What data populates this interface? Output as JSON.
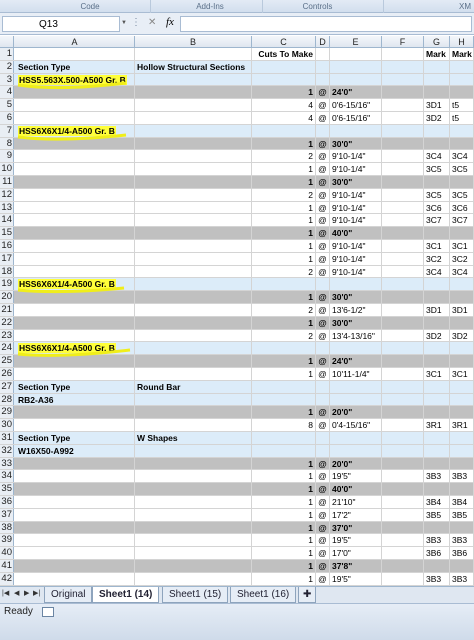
{
  "ribbon": {
    "groups": [
      "Code",
      "Add-Ins",
      "Controls",
      "XM"
    ]
  },
  "formula_bar": {
    "name_box": "Q13",
    "fx": "fx",
    "formula": ""
  },
  "columns": [
    "A",
    "B",
    "C",
    "D",
    "E",
    "F",
    "G",
    "H"
  ],
  "rows": [
    {
      "n": "1",
      "type": "plain",
      "C": "Cuts To Make",
      "G": "Mark",
      "H": "Mark"
    },
    {
      "n": "2",
      "type": "sec",
      "A": "Section Type",
      "B": "Hollow Structural Sections"
    },
    {
      "n": "3",
      "type": "sec",
      "A": "HSS5.563X.500-A500 Gr. B",
      "hl": true
    },
    {
      "n": "4",
      "type": "bar",
      "C": "1",
      "D": "@",
      "E": "24'0\""
    },
    {
      "n": "5",
      "type": "plain",
      "C": "4",
      "D": "@",
      "E": "0'6-15/16\"",
      "G": "3D1",
      "H": "t5"
    },
    {
      "n": "6",
      "type": "plain",
      "C": "4",
      "D": "@",
      "E": "0'6-15/16\"",
      "G": "3D2",
      "H": "t5"
    },
    {
      "n": "7",
      "type": "sec",
      "A": "HSS6X6X1/4-A500 Gr. B",
      "hl": true
    },
    {
      "n": "8",
      "type": "bar",
      "C": "1",
      "D": "@",
      "E": "30'0\""
    },
    {
      "n": "9",
      "type": "plain",
      "C": "2",
      "D": "@",
      "E": "9'10-1/4\"",
      "G": "3C4",
      "H": "3C4"
    },
    {
      "n": "10",
      "type": "plain",
      "C": "1",
      "D": "@",
      "E": "9'10-1/4\"",
      "G": "3C5",
      "H": "3C5"
    },
    {
      "n": "11",
      "type": "bar",
      "C": "1",
      "D": "@",
      "E": "30'0\""
    },
    {
      "n": "12",
      "type": "plain",
      "C": "2",
      "D": "@",
      "E": "9'10-1/4\"",
      "G": "3C5",
      "H": "3C5"
    },
    {
      "n": "13",
      "type": "plain",
      "C": "1",
      "D": "@",
      "E": "9'10-1/4\"",
      "G": "3C6",
      "H": "3C6"
    },
    {
      "n": "14",
      "type": "plain",
      "C": "1",
      "D": "@",
      "E": "9'10-1/4\"",
      "G": "3C7",
      "H": "3C7"
    },
    {
      "n": "15",
      "type": "bar",
      "C": "1",
      "D": "@",
      "E": "40'0\""
    },
    {
      "n": "16",
      "type": "plain",
      "C": "1",
      "D": "@",
      "E": "9'10-1/4\"",
      "G": "3C1",
      "H": "3C1"
    },
    {
      "n": "17",
      "type": "plain",
      "C": "1",
      "D": "@",
      "E": "9'10-1/4\"",
      "G": "3C2",
      "H": "3C2"
    },
    {
      "n": "18",
      "type": "plain",
      "C": "2",
      "D": "@",
      "E": "9'10-1/4\"",
      "G": "3C4",
      "H": "3C4"
    },
    {
      "n": "19",
      "type": "sec",
      "A": "HSS6X6X1/4-A500 Gr. B",
      "hl": true
    },
    {
      "n": "20",
      "type": "bar",
      "C": "1",
      "D": "@",
      "E": "30'0\""
    },
    {
      "n": "21",
      "type": "plain",
      "C": "2",
      "D": "@",
      "E": "13'6-1/2\"",
      "G": "3D1",
      "H": "3D1"
    },
    {
      "n": "22",
      "type": "bar",
      "C": "1",
      "D": "@",
      "E": "30'0\""
    },
    {
      "n": "23",
      "type": "plain",
      "C": "2",
      "D": "@",
      "E": "13'4-13/16\"",
      "G": "3D2",
      "H": "3D2"
    },
    {
      "n": "24",
      "type": "sec",
      "A": "HSS6X6X1/4-A500 Gr. B",
      "hl": true
    },
    {
      "n": "25",
      "type": "bar",
      "C": "1",
      "D": "@",
      "E": "24'0\""
    },
    {
      "n": "26",
      "type": "plain",
      "C": "1",
      "D": "@",
      "E": "10'11-1/4\"",
      "G": "3C1",
      "H": "3C1"
    },
    {
      "n": "27",
      "type": "sec",
      "A": "Section Type",
      "B": "Round Bar"
    },
    {
      "n": "28",
      "type": "sec",
      "A": "RB2-A36"
    },
    {
      "n": "29",
      "type": "bar",
      "C": "1",
      "D": "@",
      "E": "20'0\""
    },
    {
      "n": "30",
      "type": "plain",
      "C": "8",
      "D": "@",
      "E": "0'4-15/16\"",
      "G": "3R1",
      "H": "3R1"
    },
    {
      "n": "31",
      "type": "sec",
      "A": "Section Type",
      "B": "W Shapes"
    },
    {
      "n": "32",
      "type": "sec",
      "A": "W16X50-A992"
    },
    {
      "n": "33",
      "type": "bar",
      "C": "1",
      "D": "@",
      "E": "20'0\""
    },
    {
      "n": "34",
      "type": "plain",
      "C": "1",
      "D": "@",
      "E": "19'5\"",
      "G": "3B3",
      "H": "3B3"
    },
    {
      "n": "35",
      "type": "bar",
      "C": "1",
      "D": "@",
      "E": "40'0\""
    },
    {
      "n": "36",
      "type": "plain",
      "C": "1",
      "D": "@",
      "E": "21'10\"",
      "G": "3B4",
      "H": "3B4"
    },
    {
      "n": "37",
      "type": "plain",
      "C": "1",
      "D": "@",
      "E": "17'2\"",
      "G": "3B5",
      "H": "3B5"
    },
    {
      "n": "38",
      "type": "bar",
      "C": "1",
      "D": "@",
      "E": "37'0\""
    },
    {
      "n": "39",
      "type": "plain",
      "C": "1",
      "D": "@",
      "E": "19'5\"",
      "G": "3B3",
      "H": "3B3"
    },
    {
      "n": "40",
      "type": "plain",
      "C": "1",
      "D": "@",
      "E": "17'0\"",
      "G": "3B6",
      "H": "3B6"
    },
    {
      "n": "41",
      "type": "bar",
      "C": "1",
      "D": "@",
      "E": "37'8\""
    },
    {
      "n": "42",
      "type": "plain",
      "C": "1",
      "D": "@",
      "E": "19'5\"",
      "G": "3B3",
      "H": "3B3"
    }
  ],
  "tabs": [
    "Original",
    "Sheet1 (14)",
    "Sheet1 (15)",
    "Sheet1 (16)"
  ],
  "active_tab": 1,
  "status": {
    "text": "Ready"
  },
  "colors": {
    "highlight": "#ffff3a",
    "header_bar": "#c0c0c0",
    "section": "#dcecf9"
  }
}
